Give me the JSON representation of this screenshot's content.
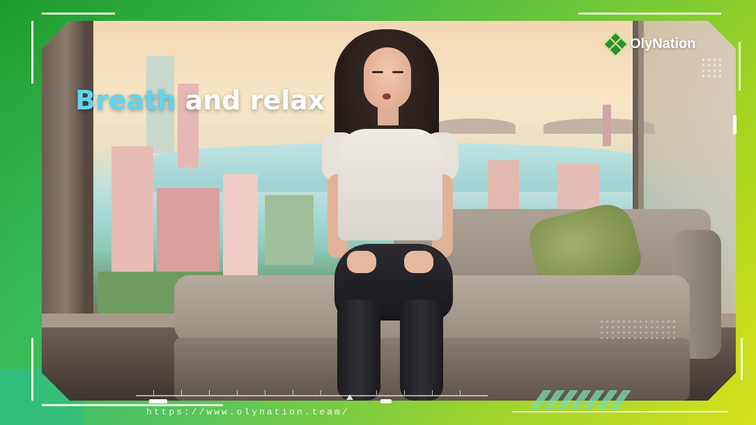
{
  "overlay": {
    "title_word1": "Breath",
    "title_word2": " and relax"
  },
  "brand": {
    "name": "OlyNation",
    "url": "https://www.olynation.team/"
  },
  "colors": {
    "title_accent": "#5fd4ee",
    "frame_start": "#1e9a2a",
    "frame_end": "#d8e21a"
  },
  "icons": {
    "logo": "olynation-logo-icon",
    "playhead": "triangle-up-icon"
  }
}
